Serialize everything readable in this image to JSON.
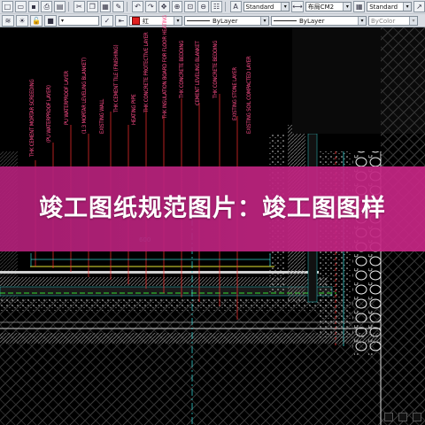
{
  "toolbar": {
    "row1": {
      "buttons": [
        "new-icon",
        "open-icon",
        "save-icon",
        "print-icon",
        "preview-icon",
        "cut-icon",
        "copy-icon",
        "paste-icon",
        "match-icon",
        "undo-icon",
        "redo-icon",
        "pan-icon",
        "zoom-icon",
        "zoom-window-icon",
        "zoom-previous-icon",
        "properties-icon"
      ],
      "text_style": "Standard",
      "dim_style": "布局CM2",
      "table_style": "Standard"
    },
    "row2": {
      "layer_color_label": "红",
      "linetype": "ByLayer",
      "lineweight": "ByLayer",
      "plot_style": "ByColor"
    }
  },
  "drawing": {
    "label_colors": {
      "pink": "#ff4d8a",
      "red": "#ff3030",
      "cyan": "#33cccc",
      "yellow": "#e6e633",
      "green": "#33dd33",
      "grey": "#8a8a8a"
    },
    "dimension_text": "600",
    "labels": [
      "EXISTING SOIL COMPACTED LAYER",
      "EXISTING STONE LAYER",
      "THK CONCRETE BEDDING",
      "CEMENT LEVELING BLANKET",
      "THK CONCRETE BEDDING",
      "THK INSULATION BOARD FOR FLOOR HEATING",
      "THK CONCRETE PROTECTIVE LAYER",
      "HEATING PIPE",
      "THK CEMENT TILE (FINISHING)",
      "EXISTING WALL",
      "(1:3 MORTAR LEVELING BLANKET)",
      "PU WATERPROOF LAYER",
      "(PU WATERPROOF LAYER)",
      "THK CEMENT MORTAR SCREEDING"
    ]
  },
  "banner": {
    "title": "竣工图纸规范图片：竣工图图样",
    "background": "#c02680"
  }
}
